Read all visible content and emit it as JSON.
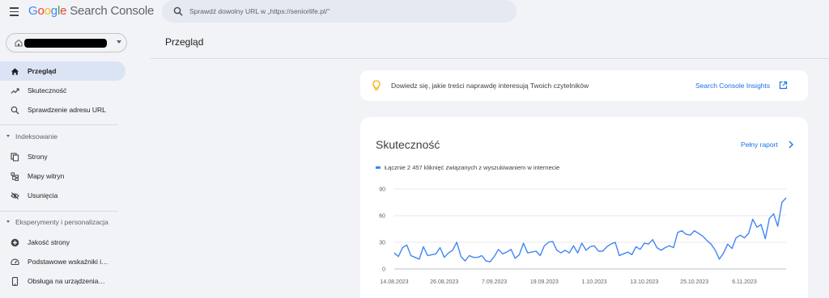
{
  "header": {
    "logo_google": [
      "G",
      "o",
      "o",
      "g",
      "l",
      "e"
    ],
    "logo_product": "Search Console",
    "search_placeholder": "Sprawdź dowolny URL w „https://seniorlife.pl/”"
  },
  "sidebar": {
    "main_items": [
      {
        "label": "Przegląd",
        "icon": "home-icon",
        "active": true
      },
      {
        "label": "Skuteczność",
        "icon": "trending-up-icon"
      },
      {
        "label": "Sprawdzenie adresu URL",
        "icon": "search-icon"
      }
    ],
    "section_indexing": "Indeksowanie",
    "indexing_items": [
      {
        "label": "Strony",
        "icon": "pages-icon"
      },
      {
        "label": "Mapy witryn",
        "icon": "sitemap-icon"
      },
      {
        "label": "Usunięcia",
        "icon": "eye-off-icon"
      }
    ],
    "section_experience": "Eksperymenty i personalizacja",
    "experience_items": [
      {
        "label": "Jakość strony",
        "icon": "plus-circle-icon"
      },
      {
        "label": "Podstawowe wskaźniki i…",
        "icon": "speedometer-icon"
      },
      {
        "label": "Obsługa na urządzenia…",
        "icon": "phone-icon"
      }
    ]
  },
  "main": {
    "title": "Przegląd",
    "insights": {
      "text": "Dowiedz się, jakie treści naprawdę interesują Twoich czytelników",
      "link": "Search Console Insights"
    },
    "performance": {
      "title": "Skuteczność",
      "link": "Pełny raport",
      "legend": "Łącznie 2 457 kliknięć związanych z wyszukiwaniem w internecie"
    }
  },
  "colors": {
    "accent": "#1a73e8",
    "series": "#4285f4",
    "active_nav": "#dbe4f5",
    "background": "#f1f3f7"
  },
  "chart_data": {
    "type": "line",
    "ylim": [
      0,
      90
    ],
    "yticks": [
      0,
      30,
      60,
      90
    ],
    "x_tick_labels": [
      "14.08.2023",
      "26.08.2023",
      "7.09.2023",
      "19.09.2023",
      "1.10.2023",
      "13.10.2023",
      "25.10.2023",
      "6.11.2023"
    ],
    "series": [
      {
        "values": [
          18,
          14,
          24,
          27,
          15,
          13,
          11,
          25,
          15,
          16,
          17,
          24,
          13,
          18,
          21,
          30,
          14,
          9,
          15,
          13,
          13,
          15,
          9,
          8,
          14,
          22,
          17,
          19,
          22,
          12,
          16,
          29,
          18,
          19,
          20,
          15,
          26,
          30,
          31,
          21,
          18,
          21,
          18,
          26,
          18,
          29,
          21,
          25,
          26,
          20,
          20,
          25,
          28,
          30,
          15,
          17,
          19,
          16,
          25,
          22,
          29,
          28,
          33,
          24,
          21,
          24,
          26,
          24,
          41,
          43,
          39,
          38,
          43,
          40,
          37,
          32,
          28,
          21,
          11,
          18,
          28,
          23,
          35,
          38,
          35,
          40,
          56,
          47,
          50,
          34,
          57,
          62,
          48,
          75,
          80
        ]
      }
    ]
  }
}
